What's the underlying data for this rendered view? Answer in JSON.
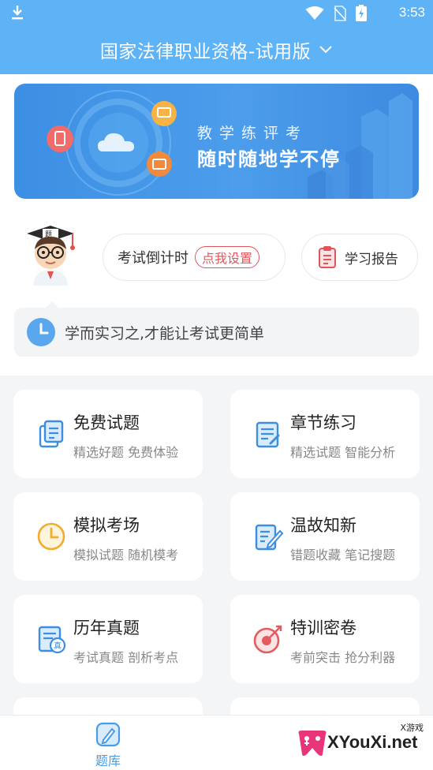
{
  "status_bar": {
    "time": "3:53",
    "icons": [
      "download-icon",
      "wifi-icon",
      "no-sim-icon",
      "battery-charging-icon"
    ]
  },
  "header": {
    "title": "国家法律职业资格-试用版",
    "dropdown_icon": "chevron-down-icon"
  },
  "banner": {
    "line1": "教学练评考",
    "line2": "随时随地学不停"
  },
  "quick_actions": {
    "countdown_label": "考试倒计时",
    "countdown_button": "点我设置",
    "report_label": "学习报告"
  },
  "motto": "学而实习之,才能让考试更简单",
  "cards": [
    {
      "title": "免费试题",
      "subtitle": "精选好题 免费体验",
      "icon": "document-icon"
    },
    {
      "title": "章节练习",
      "subtitle": "精选试题 智能分析",
      "icon": "edit-list-icon"
    },
    {
      "title": "模拟考场",
      "subtitle": "模拟试题 随机模考",
      "icon": "clock-icon"
    },
    {
      "title": "温故知新",
      "subtitle": "错题收藏 笔记搜题",
      "icon": "notes-pen-icon"
    },
    {
      "title": "历年真题",
      "subtitle": "考试真题 剖析考点",
      "icon": "past-exam-icon"
    },
    {
      "title": "特训密卷",
      "subtitle": "考前突击 抢分利器",
      "icon": "target-icon"
    }
  ],
  "tabbar": {
    "items": [
      {
        "label": "题库",
        "icon": "pencil-square-icon"
      }
    ]
  },
  "watermark": {
    "text": "XYouXi.net",
    "sub": "X游戏"
  },
  "colors": {
    "primary": "#5db3f5",
    "accent_red": "#e0555b",
    "banner_blue": "#4c9deb"
  }
}
